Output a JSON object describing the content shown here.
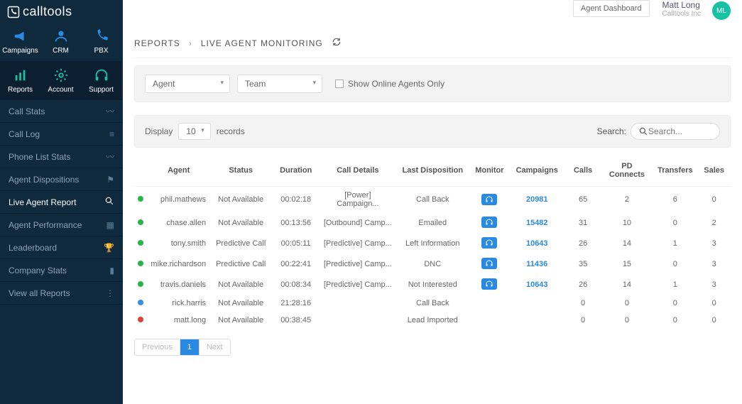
{
  "brand": "calltools",
  "top_nav": {
    "dashboard_btn": "Agent Dashboard",
    "user_name": "Matt Long",
    "company": "Calltools Inc",
    "initials": "ML"
  },
  "nav": {
    "campaigns": "Campaigns",
    "crm": "CRM",
    "pbx": "PBX",
    "reports": "Reports",
    "account": "Account",
    "support": "Support"
  },
  "sub_nav": [
    "Call Stats",
    "Call Log",
    "Phone List Stats",
    "Agent Dispositions",
    "Live Agent Report",
    "Agent Performance",
    "Leaderboard",
    "Company Stats",
    "View all Reports"
  ],
  "breadcrumb": {
    "section": "REPORTS",
    "page": "LIVE AGENT MONITORING"
  },
  "filters": {
    "agent": "Agent",
    "team": "Team",
    "online_only": "Show Online Agents Only"
  },
  "controls": {
    "display": "Display",
    "records": "records",
    "page_size": "10",
    "search_label": "Search:",
    "search_placeholder": "Search..."
  },
  "columns": [
    "Agent",
    "Status",
    "Duration",
    "Call Details",
    "Last Disposition",
    "Monitor",
    "Campaigns",
    "Calls",
    "PD Connects",
    "Transfers",
    "Sales"
  ],
  "rows": [
    {
      "dot": "green",
      "agent": "phil.mathews",
      "status": "Not Available",
      "duration": "00:02:18",
      "details": "[Power] Campaign...",
      "disposition": "Call Back",
      "monitor": true,
      "campaign": "20981",
      "calls": "65",
      "pd": "2",
      "transfers": "6",
      "sales": "0"
    },
    {
      "dot": "green",
      "agent": "chase.allen",
      "status": "Not Available",
      "duration": "00:13:56",
      "details": "[Outbound] Camp...",
      "disposition": "Emailed",
      "monitor": true,
      "campaign": "15482",
      "calls": "31",
      "pd": "10",
      "transfers": "0",
      "sales": "2"
    },
    {
      "dot": "green",
      "agent": "tony.smith",
      "status": "Predictive Call",
      "duration": "00:05:11",
      "details": "[Predictive] Camp...",
      "disposition": "Left Information",
      "monitor": true,
      "campaign": "10643",
      "calls": "26",
      "pd": "14",
      "transfers": "1",
      "sales": "3"
    },
    {
      "dot": "green",
      "agent": "mike.richardson",
      "status": "Predictive Call",
      "duration": "00:22:41",
      "details": "[Predictive] Camp...",
      "disposition": "DNC",
      "monitor": true,
      "campaign": "11436",
      "calls": "35",
      "pd": "15",
      "transfers": "0",
      "sales": "3"
    },
    {
      "dot": "green",
      "agent": "travis.daniels",
      "status": "Not Available",
      "duration": "00:08:34",
      "details": "[Predictive] Camp...",
      "disposition": "Not Interested",
      "monitor": true,
      "campaign": "10643",
      "calls": "26",
      "pd": "14",
      "transfers": "1",
      "sales": "3"
    },
    {
      "dot": "blue",
      "agent": "rick.harris",
      "status": "Not Available",
      "duration": "21:28:16",
      "details": "",
      "disposition": "Call Back",
      "monitor": false,
      "campaign": "",
      "calls": "0",
      "pd": "0",
      "transfers": "0",
      "sales": "0"
    },
    {
      "dot": "red",
      "agent": "matt.long",
      "status": "Not Available",
      "duration": "00:38:45",
      "details": "",
      "disposition": "Lead Imported",
      "monitor": false,
      "campaign": "",
      "calls": "0",
      "pd": "0",
      "transfers": "0",
      "sales": "0"
    }
  ],
  "pager": {
    "prev": "Previous",
    "page": "1",
    "next": "Next"
  }
}
